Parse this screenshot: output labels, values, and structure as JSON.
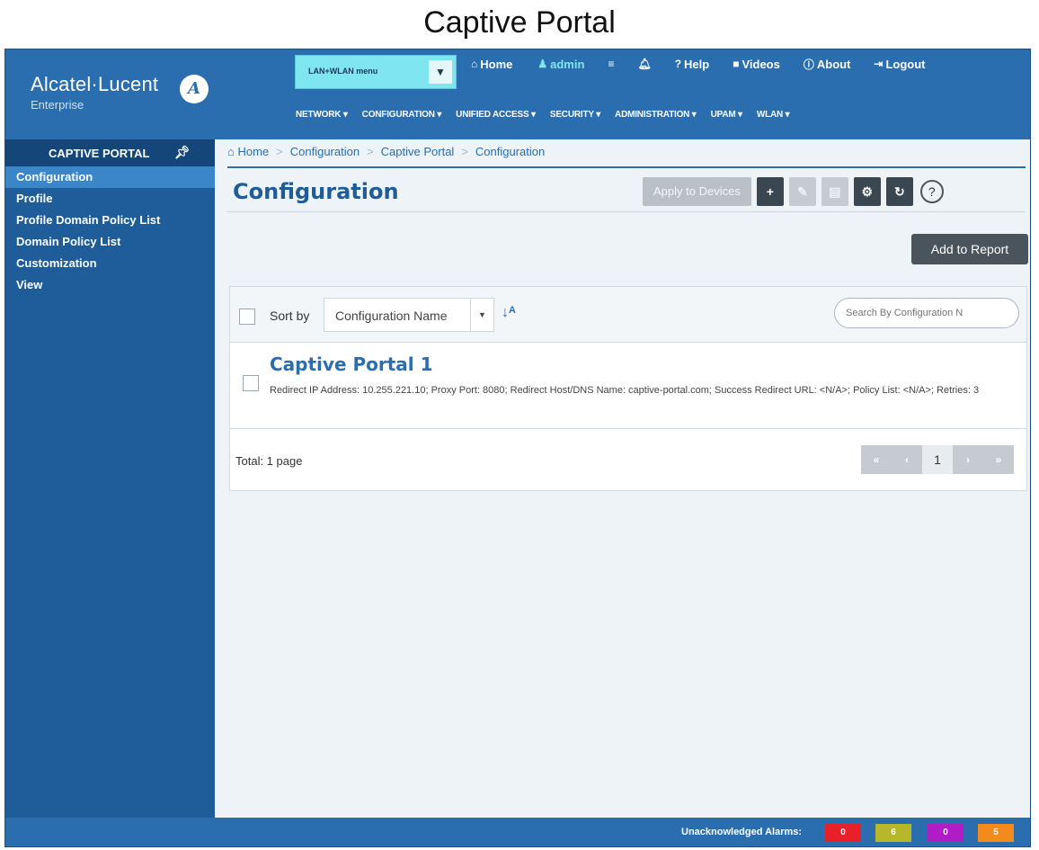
{
  "caption": "Captive Portal",
  "logo": {
    "name": "Alcatel·Lucent",
    "sub": "Enterprise"
  },
  "menu_select": {
    "value": "LAN+WLAN menu"
  },
  "toplinks": [
    {
      "icon": "home-icon",
      "glyph": "⌂",
      "label": "Home"
    },
    {
      "icon": "user-icon",
      "glyph": "♟",
      "label": "admin"
    },
    {
      "icon": "list-icon",
      "glyph": "≡",
      "label": ""
    },
    {
      "icon": "alarm-bell-icon",
      "glyph": "♫",
      "label": ""
    },
    {
      "icon": "help-icon",
      "glyph": "?",
      "label": "Help"
    },
    {
      "icon": "video-icon",
      "glyph": "■",
      "label": "Videos"
    },
    {
      "icon": "info-icon",
      "glyph": "ⓘ",
      "label": "About"
    },
    {
      "icon": "logout-icon",
      "glyph": "⇥",
      "label": "Logout"
    }
  ],
  "topnav": [
    "NETWORK ▾",
    "CONFIGURATION ▾",
    "UNIFIED ACCESS ▾",
    "SECURITY ▾",
    "ADMINISTRATION ▾",
    "UPAM ▾",
    "WLAN ▾"
  ],
  "sidebar": {
    "title": "CAPTIVE PORTAL",
    "items": [
      {
        "label": "Configuration",
        "active": true
      },
      {
        "label": "Profile"
      },
      {
        "label": "Profile Domain Policy List"
      },
      {
        "label": "Domain Policy List"
      },
      {
        "label": "Customization"
      },
      {
        "label": "View"
      }
    ]
  },
  "breadcrumb": [
    "Home",
    "Configuration",
    "Captive Portal",
    "Configuration"
  ],
  "page_title": "Configuration",
  "toolbar": {
    "apply_label": "Apply to Devices",
    "add_glyph": "+",
    "edit_glyph": "✎",
    "delete_glyph": "▤",
    "settings_glyph": "⚙",
    "refresh_glyph": "↻",
    "help_glyph": "?"
  },
  "add_to_report_label": "Add to Report",
  "sort": {
    "label": "Sort by",
    "selected": "Configuration Name",
    "search_placeholder": "Search By Configuration N"
  },
  "rows": [
    {
      "title": "Captive Portal 1",
      "description": "Redirect IP Address: 10.255.221.10; Proxy Port: 8080; Redirect Host/DNS Name: captive-portal.com; Success Redirect URL: <N/A>; Policy List: <N/A>; Retries: 3"
    }
  ],
  "pagination": {
    "total": "Total: 1 page",
    "current": "1"
  },
  "status": {
    "label": "Unacknowledged Alarms:",
    "alarms": [
      {
        "value": "0",
        "color": "#e8202a"
      },
      {
        "value": "6",
        "color": "#b7b72c"
      },
      {
        "value": "0",
        "color": "#b01cc6"
      },
      {
        "value": "5",
        "color": "#f28a1e"
      }
    ]
  }
}
